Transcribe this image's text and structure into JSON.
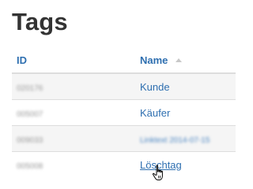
{
  "page": {
    "title": "Tags"
  },
  "table": {
    "columns": {
      "id": "ID",
      "name": "Name"
    },
    "sort_indicator": "ascending",
    "rows": [
      {
        "id": "020176",
        "name": "Kunde"
      },
      {
        "id": "005007",
        "name": "Käufer"
      },
      {
        "id": "009033",
        "name": "Linktext 2014-07-15"
      },
      {
        "id": "005008",
        "name": "Löschtag"
      }
    ]
  },
  "cursor": {
    "icon": "hand-pointer-icon"
  },
  "colors": {
    "link": "#2e6fb0",
    "title": "#333333",
    "row_stripe": "#f5f5f5",
    "border": "#dddddd"
  }
}
